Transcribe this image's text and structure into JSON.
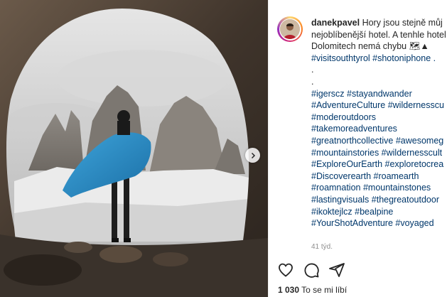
{
  "post": {
    "username": "danekpavel",
    "caption_lines": [
      " Hory jsou stejně můj",
      "nejoblíbenější hotel. A tenhle hotel v",
      "Dolomitech nemá chybu 🗺▲"
    ],
    "hashtag_lines": [
      "#visitsouthtyrol #shotoniphone .",
      ".",
      ".",
      "#igerscz #stayandwander",
      "#AdventureCulture #wildernesscu",
      "#moderoutdoors",
      "#takemoreadventures",
      "#greatnorthcollective #awesomeg",
      "#mountainstories #wildernesscult",
      "#ExploreOurEarth #exploretocrea",
      "#Discoverearth #roamearth",
      "#roamnation #mountainstones",
      "#lastingvisuals #thegreatoutdoor",
      "#ikoktejlcz #bealpine",
      "#YourShotAdventure #voyaged"
    ],
    "time_ago": "41 týd.",
    "likes_count": "1 030",
    "likes_label": " To se mi líbí"
  },
  "icons": {
    "like": "heart-icon",
    "comment": "comment-icon",
    "share": "share-icon",
    "next": "chevron-right-icon"
  },
  "colors": {
    "link": "#00376b",
    "text": "#262626",
    "muted": "#8e8e8e"
  }
}
